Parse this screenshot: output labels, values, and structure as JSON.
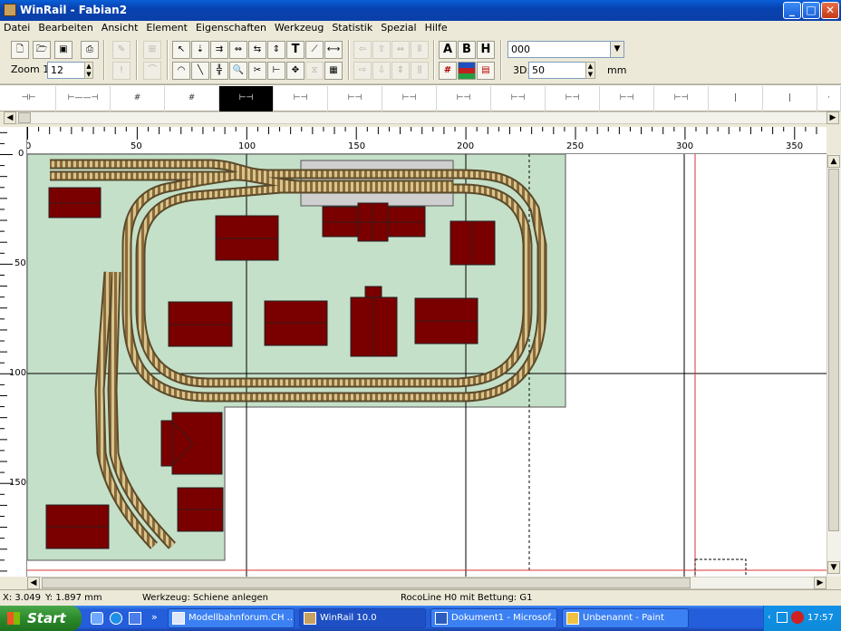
{
  "window": {
    "title": "WinRail - Fabian2",
    "minimize": "_",
    "maximize": "□",
    "close": "✕"
  },
  "menu": [
    "Datei",
    "Bearbeiten",
    "Ansicht",
    "Element",
    "Eigenschaften",
    "Werkzeug",
    "Statistik",
    "Spezial",
    "Hilfe"
  ],
  "toolbar": {
    "zoom_label": "Zoom 1:",
    "zoom_value": "12",
    "layer_value": "000",
    "threed_label": "3D:",
    "threed_value": "50",
    "unit": "mm",
    "text_a": "A",
    "text_b": "B",
    "text_h": "H",
    "text_t": "T"
  },
  "profiles": [
    "⊣⊢",
    "⊢——⊣",
    "#",
    "#",
    "⊢⊣",
    "⊢⊣",
    "⊢⊣",
    "⊢⊣",
    "⊢⊣",
    "⊢⊣",
    "⊢⊣",
    "⊢⊣",
    "⊢⊣",
    "|",
    "|",
    "·"
  ],
  "ruler": {
    "top": [
      "0",
      "50",
      "100",
      "150",
      "200",
      "250",
      "300",
      "350"
    ],
    "left": [
      "0",
      "50",
      "100",
      "150"
    ]
  },
  "status": {
    "x": "X: 3.049",
    "y": "Y: 1.897 mm",
    "tool": "Werkzeug: Schiene anlegen",
    "track": "RocoLine H0 mit Bettung: G1"
  },
  "taskbar": {
    "start": "Start",
    "tasks": [
      "Modellbahnforum.CH ...",
      "WinRail 10.0",
      "Dokument1 - Microsof...",
      "Unbenannt - Paint"
    ],
    "clock": "17:57"
  },
  "colors": {
    "baseboard": "#c5e0c9",
    "building": "#7a0000",
    "platform": "#cfcfcf",
    "redline": "#e03030"
  }
}
